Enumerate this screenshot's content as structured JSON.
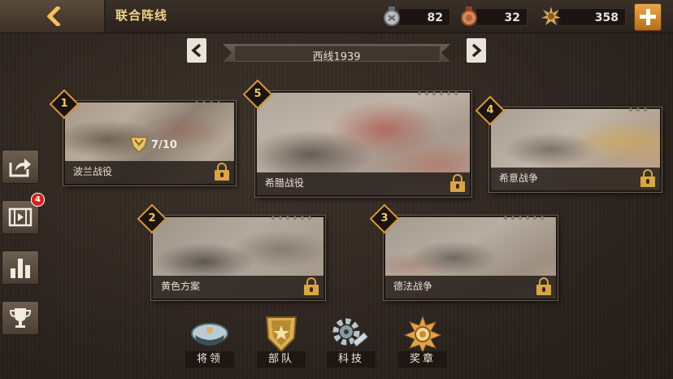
{
  "header": {
    "title": "联合阵线",
    "resources": [
      {
        "name": "silver-medal",
        "value": "82"
      },
      {
        "name": "bronze-medal",
        "value": "32"
      },
      {
        "name": "gold-star-medal",
        "value": "358"
      }
    ]
  },
  "campaign": {
    "name": "西线1939"
  },
  "battles": [
    {
      "number": "1",
      "name": "波兰战役",
      "progress": "7/10",
      "locked": true
    },
    {
      "number": "5",
      "name": "希腊战役",
      "locked": true
    },
    {
      "number": "4",
      "name": "希意战争",
      "locked": true
    },
    {
      "number": "2",
      "name": "黄色方案",
      "locked": true
    },
    {
      "number": "3",
      "name": "德法战争",
      "locked": true
    }
  ],
  "sidebar": {
    "items": [
      {
        "icon": "share-icon"
      },
      {
        "icon": "film-icon",
        "badge": "4"
      },
      {
        "icon": "bar-chart-icon"
      },
      {
        "icon": "trophy-icon"
      }
    ]
  },
  "bottom_menu": [
    {
      "label": "将领",
      "icon": "officer-cap-icon"
    },
    {
      "label": "部队",
      "icon": "army-badge-icon"
    },
    {
      "label": "科技",
      "icon": "gear-wrench-icon"
    },
    {
      "label": "奖章",
      "icon": "medal-icon"
    }
  ],
  "colors": {
    "accent": "#f3d28a",
    "lock": "#d9a548",
    "badge_border": "#d89a3a",
    "notification": "#d0261c"
  }
}
